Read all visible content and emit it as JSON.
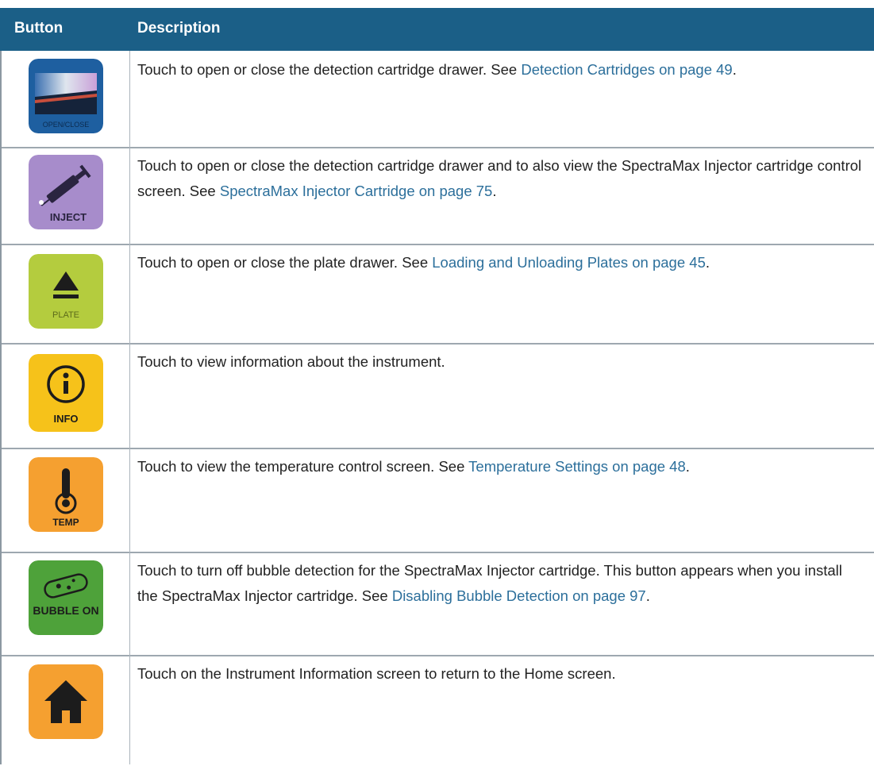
{
  "table": {
    "headers": {
      "button": "Button",
      "description": "Description"
    },
    "rows": [
      {
        "icon": "open-close-drawer-icon",
        "icon_label": "OPEN/CLOSE",
        "text": "Touch to open or close the detection cartridge drawer. See ",
        "link": "Detection Cartridges on page 49",
        "after": "."
      },
      {
        "icon": "inject-icon",
        "icon_label": "INJECT",
        "text": "Touch to open or close the detection cartridge drawer and to also view the SpectraMax Injector cartridge control screen. See ",
        "link": "SpectraMax Injector Cartridge on page 75",
        "after": "."
      },
      {
        "icon": "plate-eject-icon",
        "icon_label": "PLATE",
        "text": "Touch to open or close the plate drawer. See ",
        "link": "Loading and Unloading Plates on page 45",
        "after": "."
      },
      {
        "icon": "info-icon",
        "icon_label": "INFO",
        "text": "Touch to view information about the instrument.",
        "link": "",
        "after": ""
      },
      {
        "icon": "thermometer-icon",
        "icon_label": "TEMP",
        "text": "Touch to view the temperature control screen. See ",
        "link": "Temperature Settings on page 48",
        "after": "."
      },
      {
        "icon": "bubble-detection-icon",
        "icon_label": "BUBBLE ON",
        "text": "Touch to turn off bubble detection for the SpectraMax Injector cartridge. This button appears when you install the SpectraMax Injector cartridge. See ",
        "link": "Disabling Bubble Detection on page 97",
        "after": "."
      },
      {
        "icon": "home-icon",
        "icon_label": "",
        "text": "Touch on the Instrument Information screen to return to the Home screen.",
        "link": "",
        "after": ""
      }
    ]
  },
  "colors": {
    "header_bg": "#1b5f87",
    "link": "#2c6f9b",
    "open_close_icon": "#1e5fa0",
    "inject_icon": "#a78ccb",
    "plate_icon": "#b4cc3e",
    "info_icon": "#f6c21a",
    "temp_icon": "#f5a030",
    "bubble_icon": "#4ea23a",
    "home_icon": "#f5a030"
  }
}
